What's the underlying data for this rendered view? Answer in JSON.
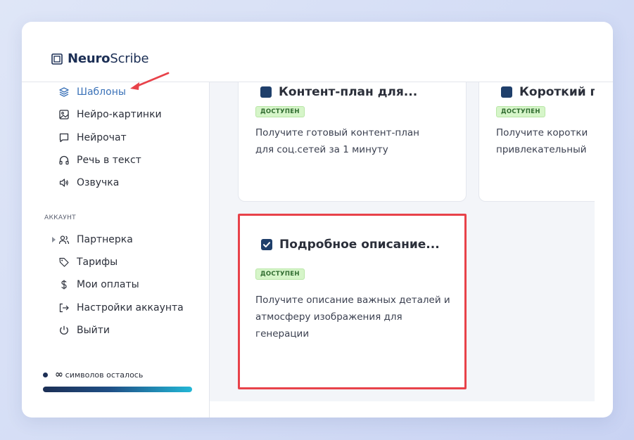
{
  "app": {
    "logo_bold": "Neuro",
    "logo_light": "Scribe"
  },
  "sidebar": {
    "items": [
      {
        "label": "Шаблоны",
        "icon": "layers-icon",
        "active": true
      },
      {
        "label": "Нейро-картинки",
        "icon": "image-icon"
      },
      {
        "label": "Нейрочат",
        "icon": "chat-icon"
      },
      {
        "label": "Речь в текст",
        "icon": "headphones-icon"
      },
      {
        "label": "Озвучка",
        "icon": "speaker-icon"
      }
    ],
    "account_label": "аккаунт",
    "account_items": [
      {
        "label": "Партнерка",
        "icon": "users-icon"
      },
      {
        "label": "Тарифы",
        "icon": "tag-icon"
      },
      {
        "label": "Мои оплаты",
        "icon": "dollar-icon"
      },
      {
        "label": "Настройки аккаунта",
        "icon": "signin-icon"
      },
      {
        "label": "Выйти",
        "icon": "power-icon"
      }
    ],
    "quota": {
      "symbol": "∞",
      "label": "символов осталось"
    }
  },
  "cards": [
    {
      "title": "Контент-план для...",
      "badge": "доступен",
      "description": "Получите готовый контент-план для соц.сетей за 1 минуту"
    },
    {
      "title": "Короткий г",
      "badge": "доступен",
      "description_line1": "Получите коротки",
      "description_line2": "привлекательный"
    },
    {
      "title": "Подробное описание...",
      "badge": "доступен",
      "description": "Получите описание важных деталей и атмосферу изображения для генерации",
      "highlighted": true
    }
  ],
  "colors": {
    "accent": "#3b72b8",
    "brand_dark": "#1c2f55",
    "badge_bg": "#d6f5c9",
    "badge_text": "#2f6b2f",
    "highlight": "#e8424a"
  }
}
